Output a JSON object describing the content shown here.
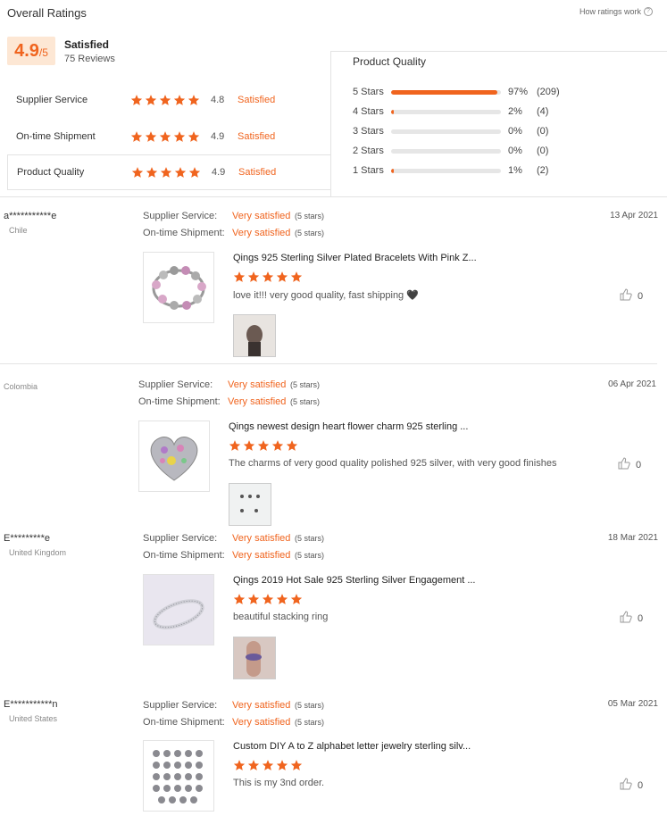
{
  "header": {
    "title": "Overall Ratings",
    "how_link": "How ratings work",
    "score": "4.9",
    "score_denom": "/5",
    "satisfaction": "Satisfied",
    "reviews": "75 Reviews"
  },
  "categories": [
    {
      "label": "Supplier Service",
      "score": "4.8",
      "status": "Satisfied",
      "stars": 5
    },
    {
      "label": "On-time Shipment",
      "score": "4.9",
      "status": "Satisfied",
      "stars": 5
    },
    {
      "label": "Product Quality",
      "score": "4.9",
      "status": "Satisfied",
      "stars": 5
    }
  ],
  "distribution": {
    "title": "Product Quality",
    "rows": [
      {
        "label": "5 Stars",
        "pct": "97%",
        "count": "(209)",
        "fill": 0.97
      },
      {
        "label": "4 Stars",
        "pct": "2%",
        "count": "(4)",
        "fill": 0.02
      },
      {
        "label": "3 Stars",
        "pct": "0%",
        "count": "(0)",
        "fill": 0
      },
      {
        "label": "2 Stars",
        "pct": "0%",
        "count": "(0)",
        "fill": 0
      },
      {
        "label": "1 Stars",
        "pct": "1%",
        "count": "(2)",
        "fill": 0.01
      }
    ]
  },
  "review_labels": {
    "supplier": "Supplier Service:",
    "shipment": "On-time Shipment:",
    "very_satisfied": "Very satisfied",
    "five_stars": "(5 stars)"
  },
  "reviews": [
    {
      "user": "a***********e",
      "country": "Chile",
      "date": "13 Apr 2021",
      "product": "Qings 925 Sterling Silver Plated Bracelets With Pink Z...",
      "text": "love it!!! very good quality, fast shipping 🖤",
      "likes": "0"
    },
    {
      "user": "",
      "country": "Colombia",
      "date": "06 Apr 2021",
      "product": "Qings newest design heart flower charm 925 sterling ...",
      "text": "The charms of very good quality polished 925 silver, with very good finishes",
      "likes": "0"
    },
    {
      "user": "E*********e",
      "country": "United Kingdom",
      "date": "18 Mar 2021",
      "product": "Qings 2019 Hot Sale 925 Sterling Silver Engagement ...",
      "text": "beautiful stacking ring",
      "likes": "0"
    },
    {
      "user": "E***********n",
      "country": "United States",
      "date": "05 Mar 2021",
      "product": "Custom DIY A to Z alphabet letter jewelry sterling silv...",
      "text": "This is my 3nd order.",
      "likes": "0"
    }
  ],
  "colors": {
    "accent": "#f0641e",
    "accent_bg": "#fde7d4"
  },
  "icons": {
    "star": "star-icon",
    "like": "thumbs-up-icon",
    "help": "question-icon"
  }
}
